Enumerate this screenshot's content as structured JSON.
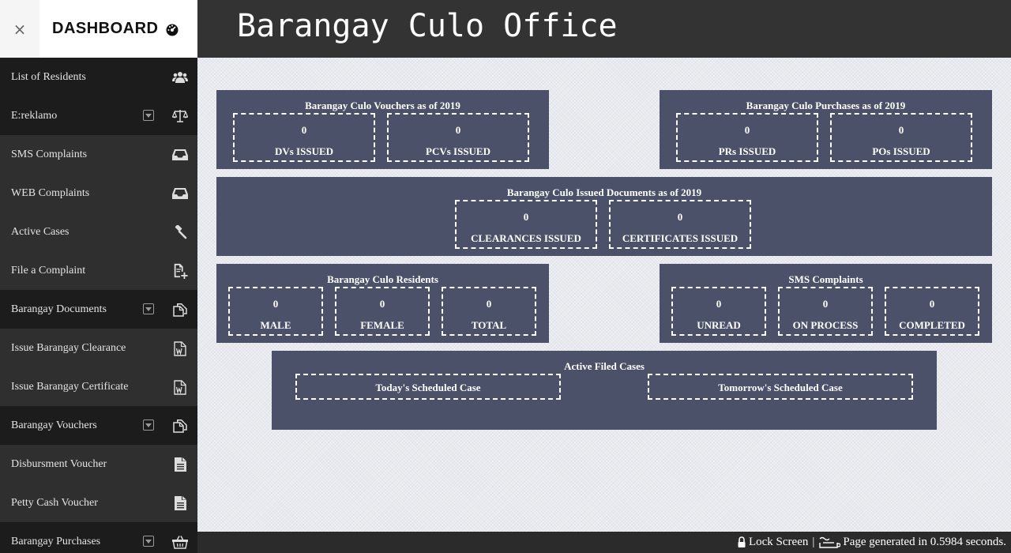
{
  "sidebar": {
    "close_glyph": "×",
    "title": "DASHBOARD",
    "title_icon": "dashboard-gauge-icon",
    "items": [
      {
        "label": "List of Residents",
        "icon": "users-icon",
        "dark": true,
        "caret": false
      },
      {
        "label": "E:reklamo",
        "icon": "balance-scale-icon",
        "dark": true,
        "caret": true
      },
      {
        "label": "SMS Complaints",
        "icon": "inbox-icon",
        "dark": false,
        "caret": false
      },
      {
        "label": "WEB Complaints",
        "icon": "inbox-icon",
        "dark": false,
        "caret": false
      },
      {
        "label": "Active Cases",
        "icon": "gavel-icon",
        "dark": false,
        "caret": false
      },
      {
        "label": "File a Complaint",
        "icon": "file-plus-icon",
        "dark": false,
        "caret": false
      },
      {
        "label": "Barangay Documents",
        "icon": "copy-icon",
        "dark": true,
        "caret": true
      },
      {
        "label": "Issue Barangay Clearance",
        "icon": "word-file-icon",
        "dark": false,
        "caret": false
      },
      {
        "label": "Issue Barangay Certificate",
        "icon": "word-file-icon",
        "dark": false,
        "caret": false
      },
      {
        "label": "Barangay Vouchers",
        "icon": "copy-icon",
        "dark": true,
        "caret": true
      },
      {
        "label": "Disbursment Voucher",
        "icon": "file-text-icon",
        "dark": false,
        "caret": false
      },
      {
        "label": "Petty Cash Voucher",
        "icon": "file-text-icon",
        "dark": false,
        "caret": false
      },
      {
        "label": "Barangay Purchases",
        "icon": "basket-icon",
        "dark": true,
        "caret": true
      }
    ]
  },
  "header": {
    "title": "Barangay Culo Office"
  },
  "panels": {
    "vouchers": {
      "title": "Barangay Culo Vouchers as of 2019",
      "stats": [
        {
          "value": "0",
          "label": "DVs ISSUED"
        },
        {
          "value": "0",
          "label": "PCVs ISSUED"
        }
      ]
    },
    "purchases": {
      "title": "Barangay Culo Purchases as of 2019",
      "stats": [
        {
          "value": "0",
          "label": "PRs ISSUED"
        },
        {
          "value": "0",
          "label": "POs ISSUED"
        }
      ]
    },
    "documents": {
      "title": "Barangay Culo Issued Documents as of 2019",
      "stats": [
        {
          "value": "0",
          "label": "CLEARANCES ISSUED"
        },
        {
          "value": "0",
          "label": "CERTIFICATES ISSUED"
        }
      ]
    },
    "residents": {
      "title": "Barangay Culo Residents",
      "stats": [
        {
          "value": "0",
          "label": "MALE"
        },
        {
          "value": "0",
          "label": "FEMALE"
        },
        {
          "value": "0",
          "label": "TOTAL"
        }
      ]
    },
    "sms": {
      "title": "SMS Complaints",
      "stats": [
        {
          "value": "0",
          "label": "UNREAD"
        },
        {
          "value": "0",
          "label": "ON PROCESS"
        },
        {
          "value": "0",
          "label": "COMPLETED"
        }
      ]
    },
    "cases": {
      "title": "Active Filed Cases",
      "items": [
        {
          "label": "Today's Scheduled Case"
        },
        {
          "label": "Tomorrow's Scheduled Case"
        }
      ]
    }
  },
  "footer": {
    "lock_label": "Lock Screen",
    "separator": "|",
    "generated_text": "Page generated in 0.5984 seconds."
  },
  "colors": {
    "panel": "#4b5168",
    "header": "#333333",
    "sidebar": "#2f2f2f",
    "sidebar_dark": "#1c1c1c"
  }
}
